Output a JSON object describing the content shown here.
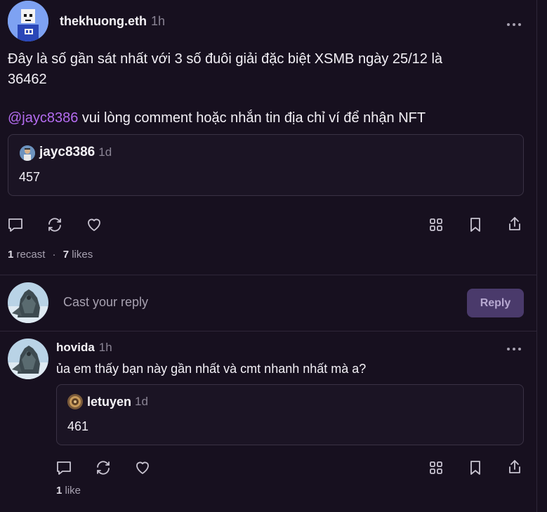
{
  "post": {
    "author": "thekhuong.eth",
    "time": "1h",
    "text_line1": "Đây là số gần sát nhất với 3 số đuôi giải đặc biệt XSMB ngày 25/12 là",
    "text_line2": "36462",
    "mention": "@jayc8386",
    "text_line3": " vui lòng comment hoặc nhắn tin địa chỉ ví để nhận NFT",
    "quote": {
      "author": "jayc8386",
      "time": "1d",
      "text": "457"
    },
    "recasts": "1",
    "recasts_label": " recast",
    "separator": "·",
    "likes": "7",
    "likes_label": " likes"
  },
  "composer": {
    "placeholder": "Cast your reply",
    "button": "Reply"
  },
  "reply": {
    "author": "hovida",
    "time": "1h",
    "text": "ủa em thấy bạn này gần nhất và cmt nhanh nhất mà a?",
    "quote": {
      "author": "letuyen",
      "time": "1d",
      "text": "461"
    },
    "likes": "1",
    "likes_label": " like"
  },
  "icons": [
    "comment-icon",
    "recast-icon",
    "heart-icon",
    "grid-icon",
    "bookmark-icon",
    "share-icon",
    "more-icon"
  ]
}
